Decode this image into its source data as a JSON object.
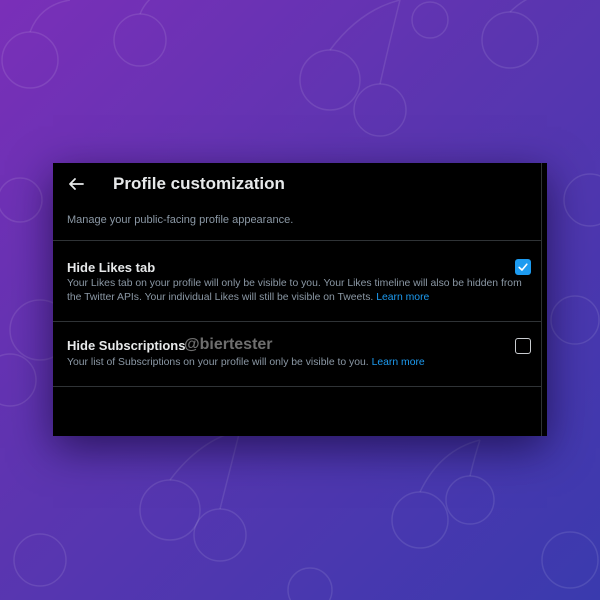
{
  "header": {
    "title": "Profile customization",
    "back_icon": "arrow-left-icon"
  },
  "description": "Manage your public-facing profile appearance.",
  "settings": [
    {
      "title": "Hide Likes tab",
      "text": "Your Likes tab on your profile will only be visible to you. Your Likes timeline will also be hidden from the Twitter APIs. Your individual Likes will still be visible on Tweets.",
      "link": "Learn more",
      "checked": true
    },
    {
      "title": "Hide Subscriptions",
      "text": "Your list of Subscriptions on your profile will only be visible to you.",
      "link": "Learn more",
      "checked": false
    }
  ],
  "watermark": "@biertester",
  "colors": {
    "accent": "#1d9bf0",
    "panel_bg": "#000000",
    "muted_text": "#8b98a5",
    "background_from": "#7a2fb8",
    "background_to": "#3a3aae"
  }
}
